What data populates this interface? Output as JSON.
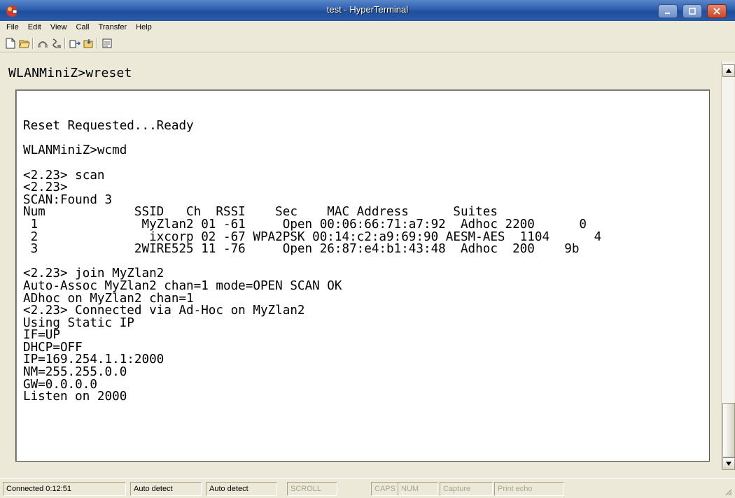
{
  "window": {
    "title": "test - HyperTerminal"
  },
  "menu": [
    "File",
    "Edit",
    "View",
    "Call",
    "Transfer",
    "Help"
  ],
  "toolbar": {
    "icons": [
      "new-icon",
      "open-icon",
      "connect-icon",
      "disconnect-icon",
      "send-icon",
      "receive-icon",
      "properties-icon"
    ]
  },
  "terminal": {
    "command_line": "WLANMiniZ>wreset",
    "output": "Reset Requested...Ready\n\nWLANMiniZ>wcmd\n\n<2.23> scan\n<2.23>\nSCAN:Found 3\nNum            SSID   Ch  RSSI    Sec    MAC Address      Suites\n 1              MyZlan2 01 -61     Open 00:06:66:71:a7:92  Adhoc 2200      0\n 2               ixcorp 02 -67 WPA2PSK 00:14:c2:a9:69:90 AESM-AES  1104      4\n 3             2WIRE525 11 -76     Open 26:87:e4:b1:43:48  Adhoc  200    9b\n\n<2.23> join MyZlan2\nAuto-Assoc MyZlan2 chan=1 mode=OPEN SCAN OK\nADhoc on MyZlan2 chan=1\n<2.23> Connected via Ad-Hoc on MyZlan2\nUsing Static IP\nIF=UP\nDHCP=OFF\nIP=169.254.1.1:2000\nNM=255.255.0.0\nGW=0.0.0.0\nListen on 2000"
  },
  "statusbar": {
    "connected": "Connected 0:12:51",
    "emulation": "Auto detect",
    "settings": "Auto detect",
    "scroll": "SCROLL",
    "caps": "CAPS",
    "num": "NUM",
    "capture": "Capture",
    "print_echo": "Print echo"
  },
  "colors": {
    "titlebar": "#2c5ead",
    "chrome": "#ece9d8",
    "terminal_bg": "#ffffff"
  }
}
